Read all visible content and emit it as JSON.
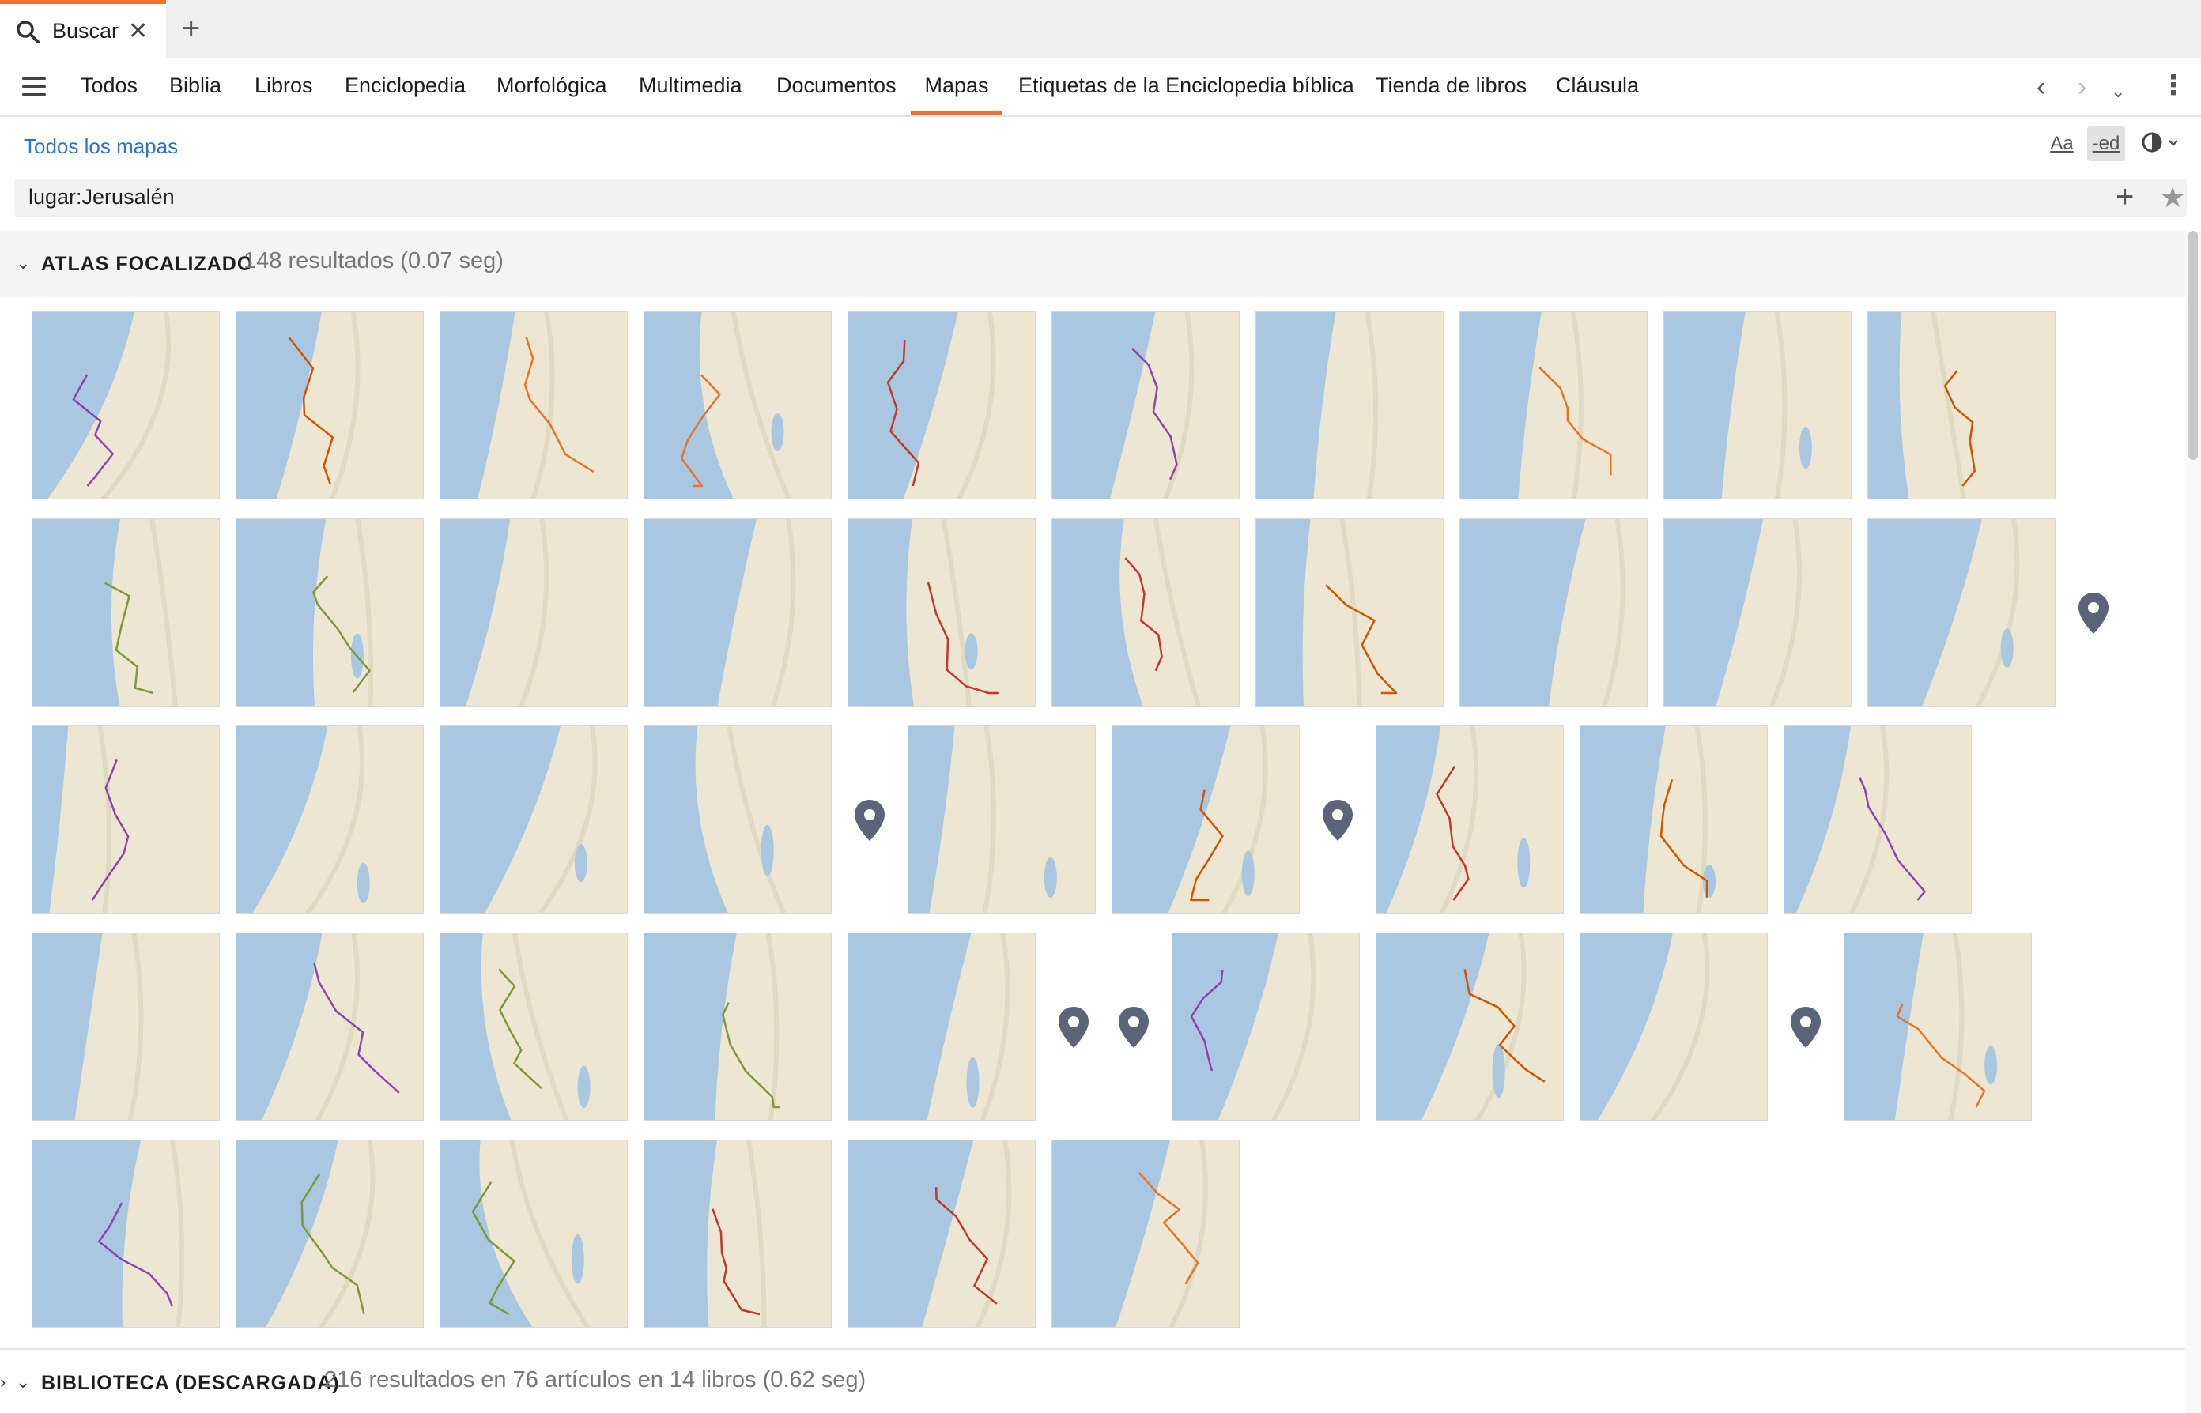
{
  "tab": {
    "label": "Buscar",
    "icon": "search-icon",
    "accent": "#f0702e"
  },
  "nav": {
    "tabs": [
      {
        "label": "Todos"
      },
      {
        "label": "Biblia"
      },
      {
        "label": "Libros"
      },
      {
        "label": "Enciclopedia"
      },
      {
        "label": "Morfológica"
      },
      {
        "label": "Multimedia"
      },
      {
        "label": "Documentos"
      },
      {
        "label": "Mapas",
        "active": true
      },
      {
        "label": "Etiquetas de la Enciclopedia bíblica"
      },
      {
        "label": "Tienda de libros"
      },
      {
        "label": "Cláusula"
      }
    ]
  },
  "search": {
    "all_maps_link": "Todos los mapas",
    "font_button": "Aa",
    "ed_button": "-ed",
    "query": "lugar:Jerusalén"
  },
  "atlas": {
    "title": "ATLAS FOCALIZADO",
    "count": "148 resultados (0.07 seg)",
    "row_layouts": [
      [
        "M",
        "M",
        "M",
        "M",
        "M",
        "M",
        "M",
        "M",
        "M",
        "M"
      ],
      [
        "M",
        "M",
        "M",
        "M",
        "M",
        "M",
        "M",
        "M",
        "M",
        "M",
        "P"
      ],
      [
        "M",
        "M",
        "M",
        "M",
        "P",
        "M",
        "M",
        "P",
        "M",
        "M",
        "M"
      ],
      [
        "M",
        "M",
        "M",
        "M",
        "M",
        "P",
        "P",
        "M",
        "M",
        "M",
        "P",
        "M"
      ],
      [
        "M",
        "M",
        "M",
        "M",
        "M",
        "M"
      ]
    ]
  },
  "library": {
    "title": "BIBLIOTECA (DESCARGADA)",
    "count": "216 resultados en 76 artículos en 14 libros (0.62 seg)"
  },
  "colors": {
    "water": "#a9c7e0",
    "land": "#ece6d2",
    "route": "#e8732c",
    "pin": "#5b6478",
    "link": "#2a74c9"
  }
}
